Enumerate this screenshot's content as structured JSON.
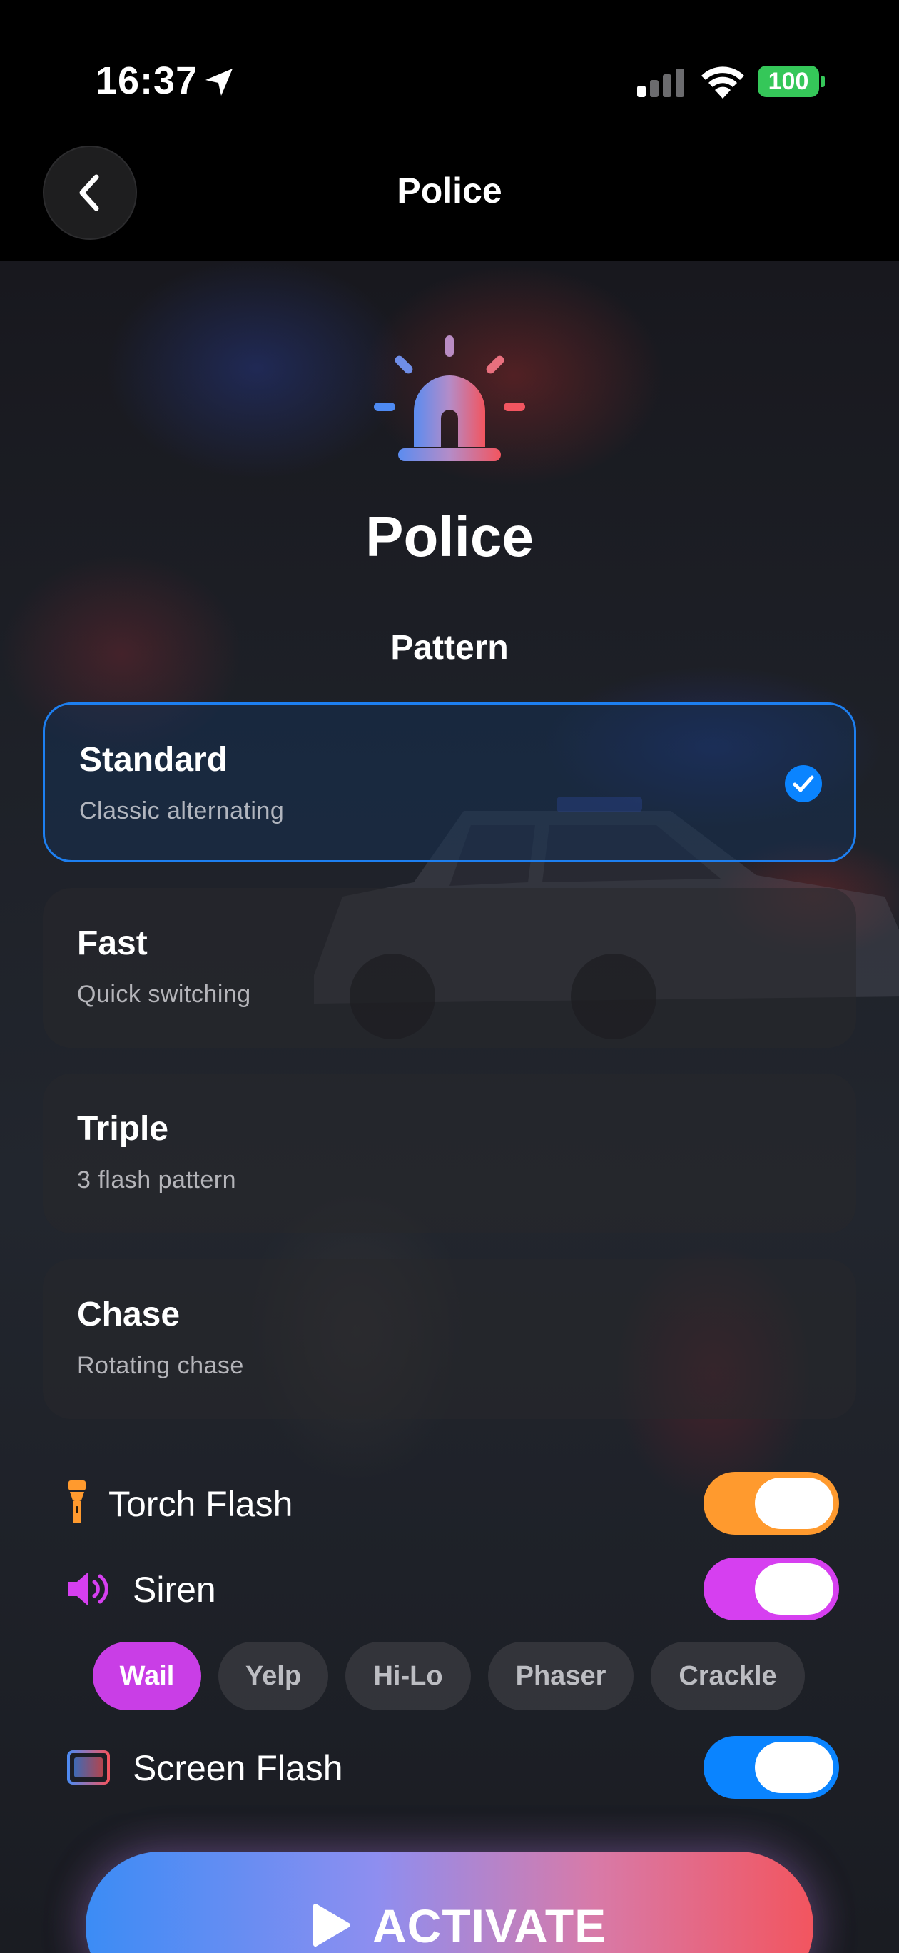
{
  "status_bar": {
    "time": "16:37",
    "battery": "100",
    "location_icon": "location-arrow-icon",
    "signal_icon": "cellular-signal-icon",
    "wifi_icon": "wifi-icon"
  },
  "nav": {
    "title": "Police",
    "back_icon": "chevron-left-icon"
  },
  "mode": {
    "icon": "siren-icon",
    "title": "Police"
  },
  "pattern_section": {
    "label": "Pattern",
    "selected_index": 0,
    "items": [
      {
        "name": "Standard",
        "description": "Classic alternating",
        "selected": true
      },
      {
        "name": "Fast",
        "description": "Quick switching",
        "selected": false
      },
      {
        "name": "Triple",
        "description": "3 flash pattern",
        "selected": false
      },
      {
        "name": "Chase",
        "description": "Rotating chase",
        "selected": false
      }
    ]
  },
  "toggles": {
    "torch": {
      "label": "Torch Flash",
      "icon": "flashlight-icon",
      "on": true,
      "color": "#ff9a2e"
    },
    "siren": {
      "label": "Siren",
      "icon": "speaker-icon",
      "on": true,
      "color": "#d63ff0"
    },
    "screen": {
      "label": "Screen Flash",
      "icon": "screen-icon",
      "on": true,
      "color": "#0a84ff"
    }
  },
  "siren_sounds": {
    "selected": "Wail",
    "options": [
      "Wail",
      "Yelp",
      "Hi-Lo",
      "Phaser",
      "Crackle"
    ]
  },
  "activate": {
    "label": "ACTIVATE",
    "icon": "play-icon"
  },
  "colors": {
    "accent_blue": "#0a84ff",
    "accent_pink": "#c93ee6",
    "accent_orange": "#ff9a2e",
    "gradient_start": "#3b8cf5",
    "gradient_end": "#f2555f"
  }
}
